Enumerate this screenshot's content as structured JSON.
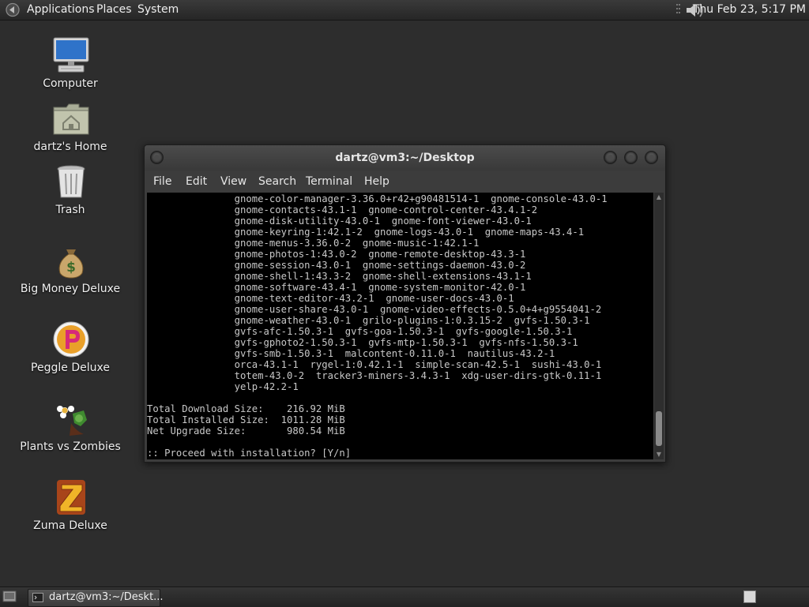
{
  "top_panel": {
    "menus": [
      "Applications",
      "Places",
      "System"
    ],
    "clock": "Thu Feb 23,  5:17 PM"
  },
  "desktop_icons": [
    {
      "label": "Computer",
      "icon": "computer-monitor-icon"
    },
    {
      "label": "dartz's Home",
      "icon": "home-folder-icon"
    },
    {
      "label": "Trash",
      "icon": "trash-can-icon"
    },
    {
      "label": "Big Money Deluxe",
      "icon": "money-bag-icon"
    },
    {
      "label": "Peggle Deluxe",
      "icon": "peggle-ball-icon"
    },
    {
      "label": "Plants vs Zombies",
      "icon": "plants-flower-icon"
    },
    {
      "label": "Zuma Deluxe",
      "icon": "zuma-z-icon"
    }
  ],
  "terminal": {
    "title": "dartz@vm3:~/Desktop",
    "menu": [
      "File",
      "Edit",
      "View",
      "Search",
      "Terminal",
      "Help"
    ],
    "lines": [
      "               gnome-color-manager-3.36.0+r42+g90481514-1  gnome-console-43.0-1",
      "               gnome-contacts-43.1-1  gnome-control-center-43.4.1-2",
      "               gnome-disk-utility-43.0-1  gnome-font-viewer-43.0-1",
      "               gnome-keyring-1:42.1-2  gnome-logs-43.0-1  gnome-maps-43.4-1",
      "               gnome-menus-3.36.0-2  gnome-music-1:42.1-1",
      "               gnome-photos-1:43.0-2  gnome-remote-desktop-43.3-1",
      "               gnome-session-43.0-1  gnome-settings-daemon-43.0-2",
      "               gnome-shell-1:43.3-2  gnome-shell-extensions-43.1-1",
      "               gnome-software-43.4-1  gnome-system-monitor-42.0-1",
      "               gnome-text-editor-43.2-1  gnome-user-docs-43.0-1",
      "               gnome-user-share-43.0-1  gnome-video-effects-0.5.0+4+g9554041-2",
      "               gnome-weather-43.0-1  grilo-plugins-1:0.3.15-2  gvfs-1.50.3-1",
      "               gvfs-afc-1.50.3-1  gvfs-goa-1.50.3-1  gvfs-google-1.50.3-1",
      "               gvfs-gphoto2-1.50.3-1  gvfs-mtp-1.50.3-1  gvfs-nfs-1.50.3-1",
      "               gvfs-smb-1.50.3-1  malcontent-0.11.0-1  nautilus-43.2-1",
      "               orca-43.1-1  rygel-1:0.42.1-1  simple-scan-42.5-1  sushi-43.0-1",
      "               totem-43.0-2  tracker3-miners-3.4.3-1  xdg-user-dirs-gtk-0.11-1",
      "               yelp-42.2-1",
      "",
      "Total Download Size:    216.92 MiB",
      "Total Installed Size:  1011.28 MiB",
      "Net Upgrade Size:       980.54 MiB",
      "",
      ":: Proceed with installation? [Y/n]"
    ]
  },
  "taskbar": {
    "window_button": "dartz@vm3:~/Deskt..."
  }
}
